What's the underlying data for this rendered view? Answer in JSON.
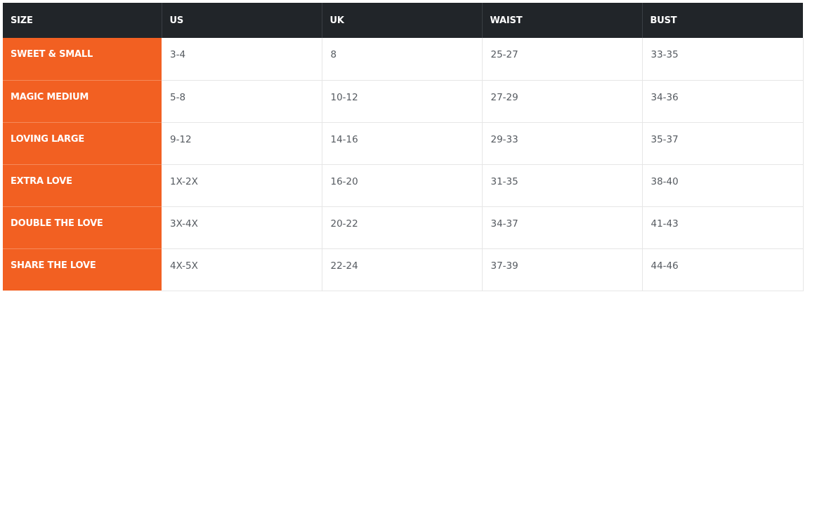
{
  "colors": {
    "header_bg": "#212529",
    "accent": "#f26022",
    "cell_text": "#555a60",
    "grid_line": "#e6e6e6"
  },
  "table": {
    "headers": [
      "SIZE",
      "US",
      "UK",
      "WAIST",
      "BUST"
    ],
    "rows": [
      [
        "SWEET & SMALL",
        "3-4",
        "8",
        "25-27",
        "33-35"
      ],
      [
        "MAGIC MEDIUM",
        "5-8",
        "10-12",
        "27-29",
        "34-36"
      ],
      [
        "LOVING LARGE",
        "9-12",
        "14-16",
        "29-33",
        "35-37"
      ],
      [
        "EXTRA LOVE",
        "1X-2X",
        "16-20",
        "31-35",
        "38-40"
      ],
      [
        "DOUBLE THE LOVE",
        "3X-4X",
        "20-22",
        "34-37",
        "41-43"
      ],
      [
        "SHARE THE LOVE",
        "4X-5X",
        "22-24",
        "37-39",
        "44-46"
      ]
    ]
  }
}
